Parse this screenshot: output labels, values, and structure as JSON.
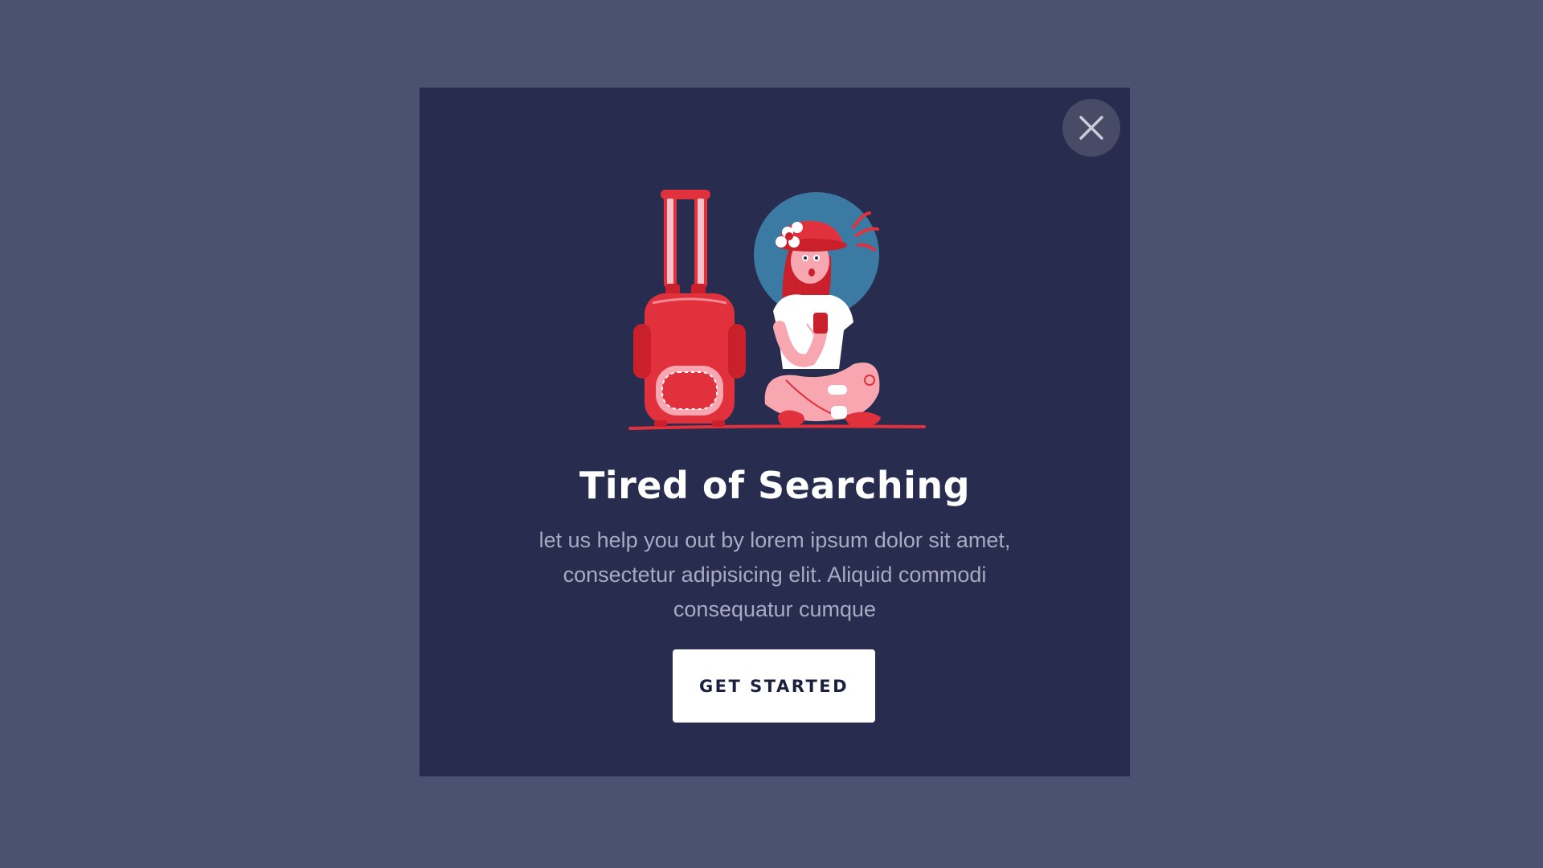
{
  "modal": {
    "title": "Tired of Searching",
    "body": "let us help you out by lorem ipsum dolor sit amet, consectetur adipisicing elit. Aliquid commodi consequatur cumque",
    "cta_label": "GET STARTED",
    "close_icon": "close-icon",
    "illustration": "traveler-with-suitcase-illustration"
  },
  "colors": {
    "page_background": "#4b5170",
    "modal_background": "#282d4f",
    "close_button_background": "#474b66",
    "accent_red": "#e0313d",
    "accent_blue": "#3b7ba3",
    "body_text": "#a7abc2",
    "button_background": "#ffffff",
    "button_text": "#1c2040"
  }
}
